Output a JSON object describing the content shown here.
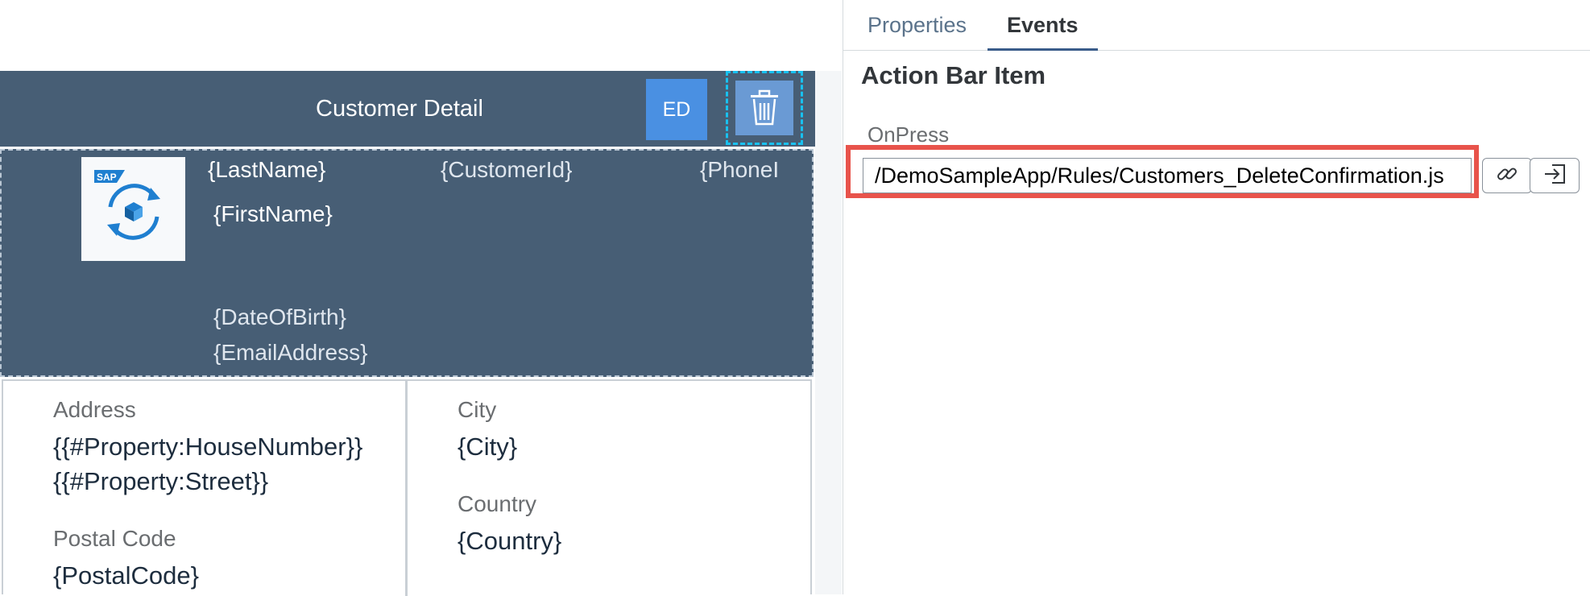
{
  "canvas": {
    "action_bar": {
      "title": "Customer Detail",
      "ed_button_label": "ED",
      "delete_icon": "trash-icon"
    },
    "header": {
      "logo_icon": "sap-sync-icon",
      "logo_text": "SAP",
      "last_name": "{LastName}",
      "first_name": "{FirstName}",
      "customer_id": "{CustomerId}",
      "phone": "{PhoneI",
      "date_of_birth": "{DateOfBirth}",
      "email": "{EmailAddress}"
    },
    "form": {
      "address_label": "Address",
      "address_line1": "{{#Property:HouseNumber}}",
      "address_line2": "{{#Property:Street}}",
      "postal_label": "Postal Code",
      "postal_value": "{PostalCode}",
      "city_label": "City",
      "city_value": "{City}",
      "country_label": "Country",
      "country_value": "{Country}"
    }
  },
  "panel": {
    "tabs": [
      {
        "label": "Properties",
        "active": false
      },
      {
        "label": "Events",
        "active": true
      }
    ],
    "section_title": "Action Bar Item",
    "onpress": {
      "label": "OnPress",
      "value": "/DemoSampleApp/Rules/Customers_DeleteConfirmation.js",
      "link_icon": "link-icon",
      "bind_icon": "open-in-icon"
    },
    "colors": {
      "action_bar": "#475e75",
      "highlight": "#e8534b",
      "selection": "#18c1f0",
      "accent": "#4a90e2"
    }
  }
}
